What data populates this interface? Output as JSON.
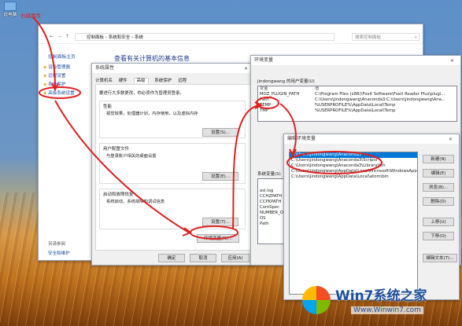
{
  "desktop": {
    "icon_label": "此电脑",
    "annotation": "右键属性"
  },
  "system_window": {
    "breadcrumb": [
      "控制面板",
      "系统和安全",
      "系统"
    ],
    "search_placeholder": "搜索控制面板",
    "sidebar_home": "控制面板主页",
    "sidebar_links": [
      "设备管理器",
      "远程设置",
      "系统保护",
      "高级系统设置"
    ],
    "see_also": "另请参阅",
    "security": "安全和维护",
    "heading": "查看有关计算机的基本信息"
  },
  "sysprops": {
    "title": "系统属性",
    "tabs": [
      "计算机名",
      "硬件",
      "高级",
      "系统保护",
      "远程"
    ],
    "admin_note": "要进行大多数更改，你必须作为管理员登录。",
    "perf_title": "性能",
    "perf_desc": "视觉效果，处理器计划，内存使用，以及虚拟内存",
    "profile_title": "用户配置文件",
    "profile_desc": "与登录账户相关的桌面设置",
    "startup_title": "启动和故障恢复",
    "startup_desc": "系统启动、系统故障和调试信息",
    "settings_btn": "设置(S)...",
    "settings_btn2": "设置(E)...",
    "settings_btn3": "设置(T)...",
    "envvars_btn": "环境变量(N)...",
    "ok": "确定",
    "cancel": "取消",
    "apply": "应用(A)"
  },
  "envwin": {
    "title": "环境变量",
    "user_vars_label": "jindongwang 的用户变量(U)",
    "col_var": "变量",
    "col_val": "值",
    "user_vars": [
      {
        "name": "MOZ_PLUGIN_PATH",
        "value": "C:\\Program Files (x86)\\Foxit Software\\Foxit Reader Plus\\plugi..."
      },
      {
        "name": "Path",
        "value": "C:\\Users\\jindongwang\\Anaconda3;C:\\Users\\jindongwang\\Ana..."
      },
      {
        "name": "TEMP",
        "value": "%USERPROFILE%\\AppData\\Local\\Temp"
      },
      {
        "name": "TMP",
        "value": "%USERPROFILE%\\AppData\\Local\\Temp"
      }
    ],
    "sys_vars_label": "系统变量(S)",
    "sys_vars": [
      "asl.log",
      "CCHZPATH",
      "CCPKPATH",
      "ComSpec",
      "NUMBER_O",
      "OS",
      "Path"
    ]
  },
  "editenv": {
    "title": "编辑环境变量",
    "entries": [
      "C:\\Users\\jindongwang\\Anaconda3",
      "C:\\Users\\jindongwang\\Anaconda3\\Scripts",
      "C:\\Users\\jindongwang\\Anaconda3\\Library\\bin",
      "C:\\Users\\jindongwang\\AppData\\Local\\Microsoft\\WindowsApps",
      "C:\\Users\\jindongwang\\AppData\\Local\\atom\\bin"
    ],
    "buttons": [
      "新建(N)",
      "编辑(E)",
      "浏览(B)...",
      "删除(D)",
      "上移(U)",
      "下移(O)",
      "编辑文本(T)..."
    ]
  },
  "watermark": {
    "brand": "Win7系统之家",
    "url": "Www.Winwin7.com"
  }
}
